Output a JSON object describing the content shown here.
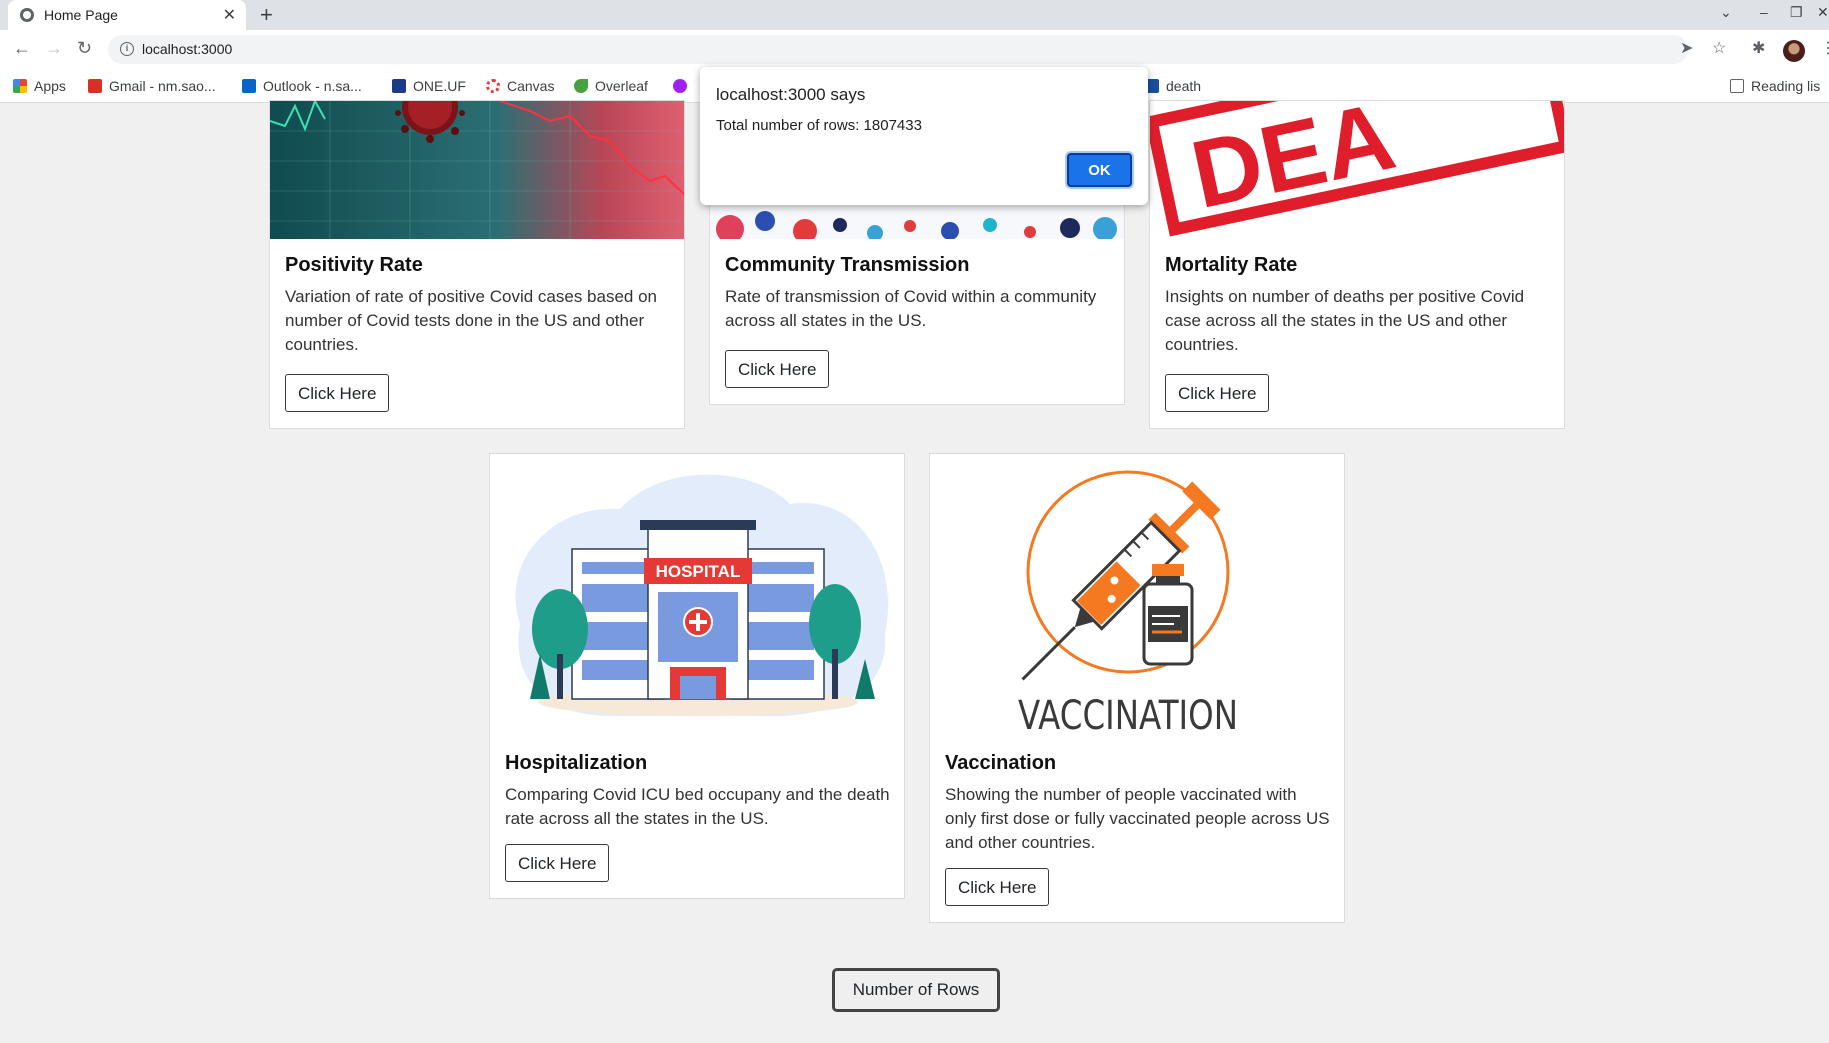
{
  "browser": {
    "tab_title": "Home Page",
    "tab_close": "✕",
    "new_tab": "+",
    "url": "localhost:3000",
    "window_controls": [
      "⌄",
      "–",
      "❐",
      "✕"
    ]
  },
  "bookmarks": [
    {
      "label": "Apps",
      "color": "#ea4335"
    },
    {
      "label": "Gmail - nm.sao...",
      "color": "#d93025"
    },
    {
      "label": "Outlook - n.sa...",
      "color": "#0a64c8"
    },
    {
      "label": "ONE.UF",
      "color": "#1a3a8a"
    },
    {
      "label": "Canvas",
      "color": "#e13c3c"
    },
    {
      "label": "Overleaf",
      "color": "#47a141"
    },
    {
      "label": "death",
      "color": "#1a4fa0"
    },
    {
      "label": "Reading lis",
      "color": "#5f6368"
    }
  ],
  "cards": [
    {
      "title": "Positivity Rate",
      "description": "Variation of rate of positive Covid cases based on number of Covid tests done in the US and other countries.",
      "button": "Click Here"
    },
    {
      "title": "Community Transmission",
      "description": "Rate of transmission of Covid within a community across all states in the US.",
      "button": "Click Here"
    },
    {
      "title": "Mortality Rate",
      "description": "Insights on number of deaths per positive Covid case across all the states in the US and other countries.",
      "button": "Click Here"
    },
    {
      "title": "Hospitalization",
      "description": "Comparing Covid ICU bed occupany and the death rate across all the states in the US.",
      "button": "Click Here"
    },
    {
      "title": "Vaccination",
      "description": "Showing the number of people vaccinated with only first dose or fully vaccinated people across US and other countries.",
      "button": "Click Here"
    }
  ],
  "image_text": {
    "hospital_sign": "HOSPITAL",
    "vaccination_label": "VACCINATION",
    "death_stamp": "DEA"
  },
  "rows_button": "Number of Rows",
  "dialog": {
    "title": "localhost:3000 says",
    "message": "Total number of rows: 1807433",
    "ok": "OK"
  },
  "colors": {
    "accent_blue": "#1a73e8",
    "vaccine_orange": "#f47920",
    "stamp_red": "#e01e2b"
  }
}
